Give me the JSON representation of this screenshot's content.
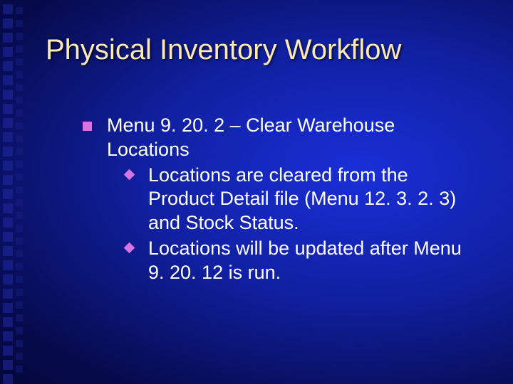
{
  "slide": {
    "title": "Physical Inventory Workflow",
    "level1": {
      "text": "Menu 9. 20. 2 – Clear Warehouse Locations",
      "children": [
        {
          "text": "Locations are cleared from the Product Detail file (Menu 12. 3. 2. 3) and Stock Status."
        },
        {
          "text": "Locations will be updated after Menu 9. 20. 12 is run."
        }
      ]
    }
  }
}
